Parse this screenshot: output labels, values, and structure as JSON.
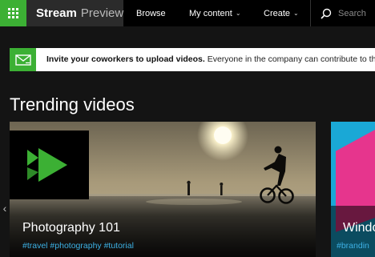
{
  "header": {
    "brand_name": "Stream",
    "brand_sub": "Preview",
    "nav": [
      {
        "label": "Browse"
      },
      {
        "label": "My content"
      },
      {
        "label": "Create"
      }
    ],
    "search_placeholder": "Search",
    "accent_color": "#3cb034"
  },
  "banner": {
    "bold_text": "Invite your coworkers to upload videos.",
    "text": " Everyone in the company can contribute to the Strea"
  },
  "section": {
    "title": "Trending videos"
  },
  "videos": [
    {
      "title": "Photography 101",
      "tags": "#travel #photography #tutorial"
    },
    {
      "title": "Windo",
      "tags": "#brandin"
    }
  ],
  "icons": {
    "app_launcher": "waffle-icon",
    "search": "search-icon",
    "mail": "mail-icon",
    "scroll_left": "chevron-left-icon"
  }
}
